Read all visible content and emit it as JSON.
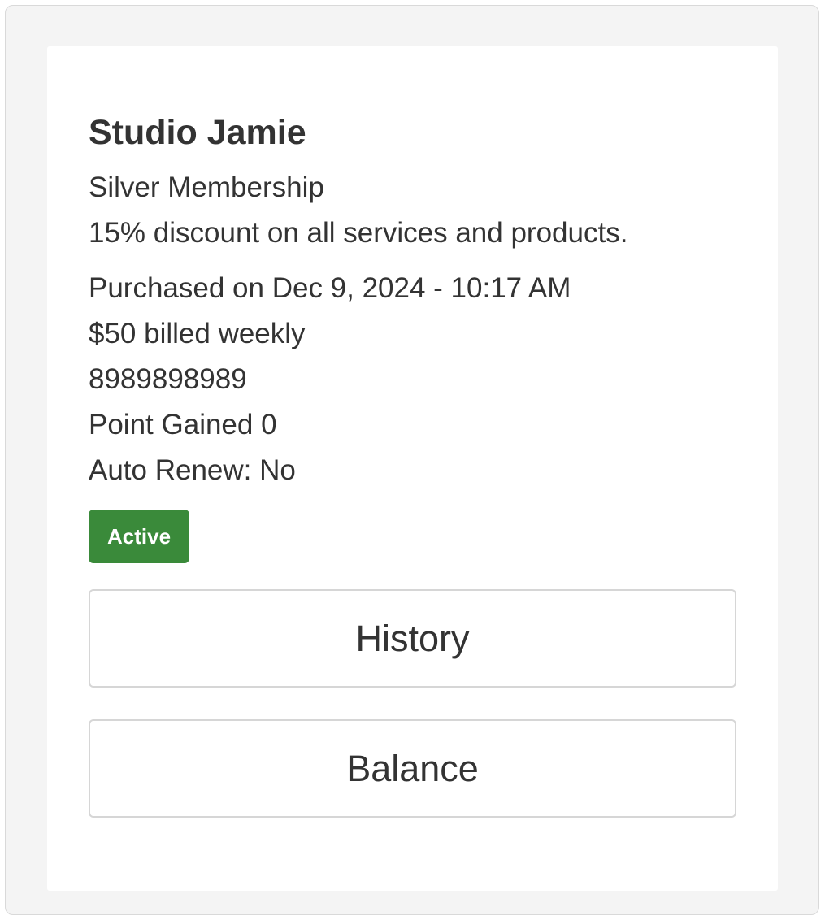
{
  "card": {
    "studio_name": "Studio Jamie",
    "membership_name": "Silver Membership",
    "membership_description": "15% discount on all services and products.",
    "details": {
      "purchase_date": "Purchased on Dec 9, 2024 - 10:17 AM",
      "billing": "$50 billed weekly",
      "phone": "8989898989",
      "points": "Point Gained 0",
      "auto_renew": "Auto Renew: No"
    },
    "status": {
      "label": "Active",
      "color": "#3a8a3a"
    },
    "buttons": {
      "history_label": "History",
      "balance_label": "Balance"
    }
  },
  "colors": {
    "frame_background": "#f4f4f4",
    "card_background": "#ffffff",
    "text": "#333333",
    "button_border": "#d6d6d6"
  }
}
